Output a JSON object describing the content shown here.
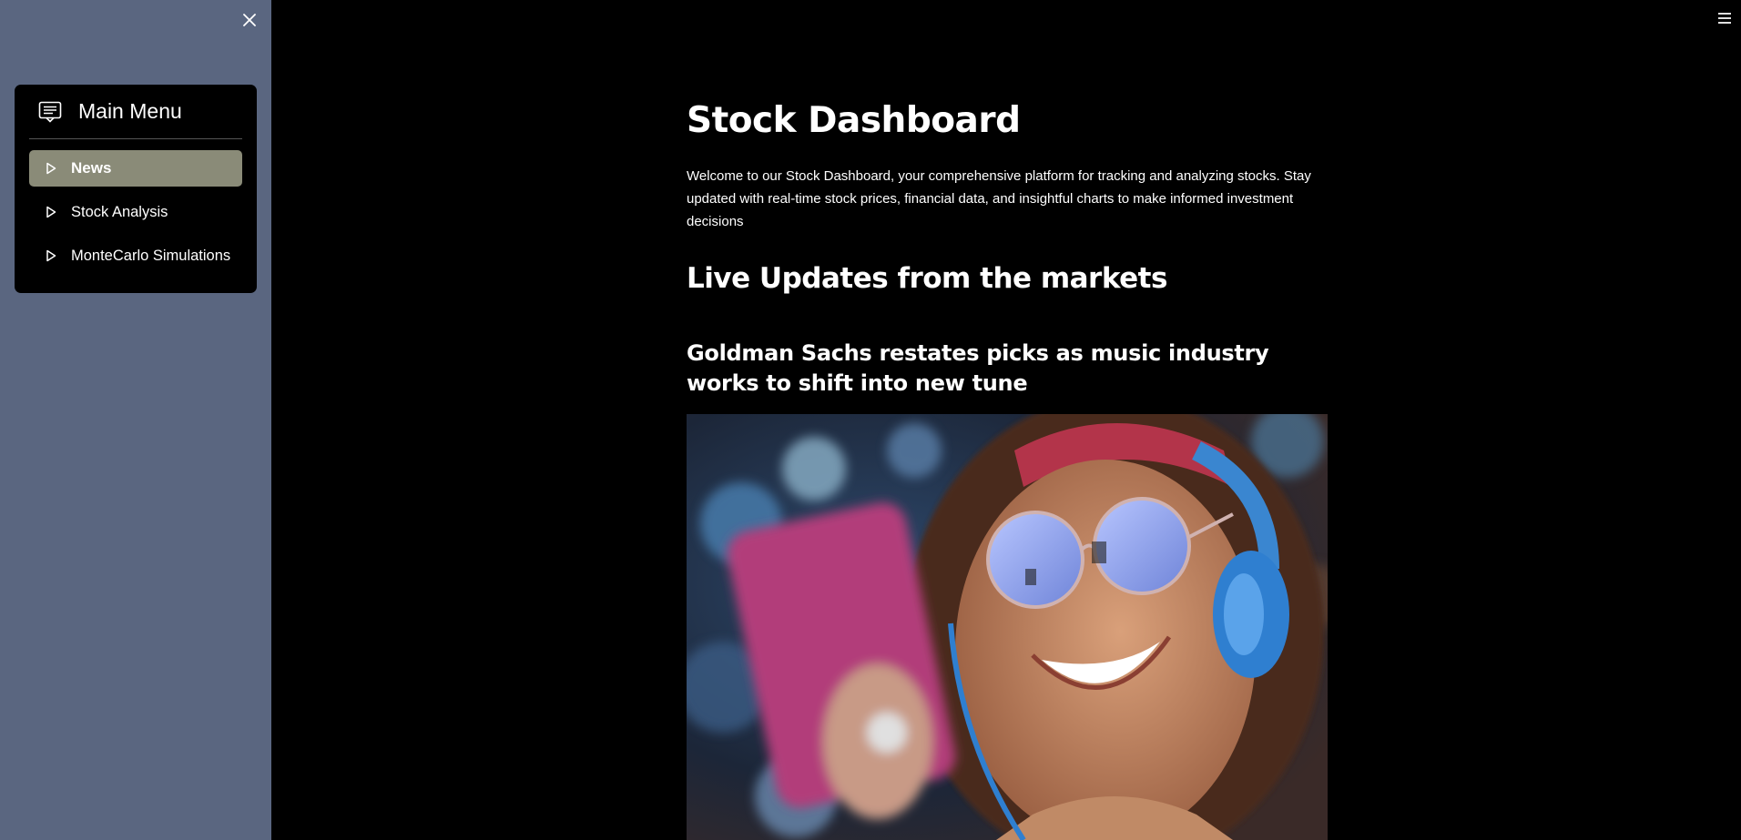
{
  "sidebar": {
    "close_icon": "close-icon",
    "menu": {
      "title": "Main Menu",
      "icon": "menu-card-icon",
      "items": [
        {
          "label": "News",
          "active": true
        },
        {
          "label": "Stock Analysis",
          "active": false
        },
        {
          "label": "MonteCarlo Simulations",
          "active": false
        }
      ]
    }
  },
  "header": {
    "hamburger_icon": "hamburger-icon"
  },
  "main": {
    "title": "Stock Dashboard",
    "intro": "Welcome to our Stock Dashboard, your comprehensive platform for tracking and analyzing stocks. Stay updated with real-time stock prices, financial data, and insightful charts to make informed investment decisions",
    "section_heading": "Live Updates from the markets",
    "articles": [
      {
        "title": "Goldman Sachs restates picks as music industry works to shift into new tune",
        "image": "woman-with-headphones-photo"
      }
    ]
  },
  "colors": {
    "sidebar_bg": "#5a6680",
    "active_item_bg": "#8a8b78",
    "main_bg": "#000000"
  }
}
